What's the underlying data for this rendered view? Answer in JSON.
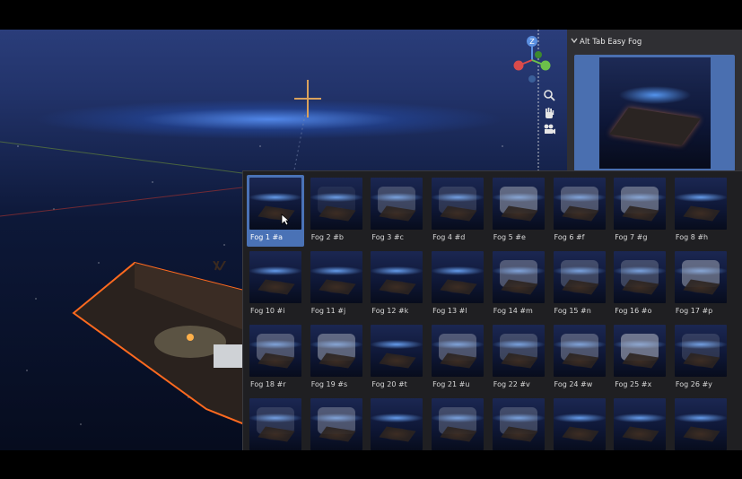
{
  "panel": {
    "title": "Alt Tab Easy Fog",
    "collapse_icon": "chevron-down-icon"
  },
  "viewport": {
    "gizmo_axes": [
      "Z",
      "Y",
      "X"
    ],
    "nav_icons": [
      "zoom-icon",
      "pan-hand-icon",
      "camera-icon"
    ]
  },
  "fog_presets": [
    {
      "label": "Fog 1 #a",
      "selected": true,
      "fog": 0.0
    },
    {
      "label": "Fog 2 #b",
      "selected": false,
      "fog": 0.1
    },
    {
      "label": "Fog 3 #c",
      "selected": false,
      "fog": 0.3
    },
    {
      "label": "Fog 4 #d",
      "selected": false,
      "fog": 0.2
    },
    {
      "label": "Fog 5 #e",
      "selected": false,
      "fog": 0.5
    },
    {
      "label": "Fog 6 #f",
      "selected": false,
      "fog": 0.4
    },
    {
      "label": "Fog 7 #g",
      "selected": false,
      "fog": 0.5
    },
    {
      "label": "Fog 8 #h",
      "selected": false,
      "fog": 0.0
    },
    {
      "label": "Fog 10 #i",
      "selected": false,
      "fog": 0.0
    },
    {
      "label": "Fog 11 #j",
      "selected": false,
      "fog": 0.0
    },
    {
      "label": "Fog 12 #k",
      "selected": false,
      "fog": 0.0
    },
    {
      "label": "Fog 13 #l",
      "selected": false,
      "fog": 0.0
    },
    {
      "label": "Fog 14 #m",
      "selected": false,
      "fog": 0.4
    },
    {
      "label": "Fog 15 #n",
      "selected": false,
      "fog": 0.3
    },
    {
      "label": "Fog 16 #o",
      "selected": false,
      "fog": 0.3
    },
    {
      "label": "Fog 17 #p",
      "selected": false,
      "fog": 0.5
    },
    {
      "label": "Fog 18 #r",
      "selected": false,
      "fog": 0.4
    },
    {
      "label": "Fog 19 #s",
      "selected": false,
      "fog": 0.5
    },
    {
      "label": "Fog 20 #t",
      "selected": false,
      "fog": 0.0
    },
    {
      "label": "Fog 21 #u",
      "selected": false,
      "fog": 0.4
    },
    {
      "label": "Fog 22 #v",
      "selected": false,
      "fog": 0.3
    },
    {
      "label": "Fog 24 #w",
      "selected": false,
      "fog": 0.4
    },
    {
      "label": "Fog 25 #x",
      "selected": false,
      "fog": 0.6
    },
    {
      "label": "Fog 26 #y",
      "selected": false,
      "fog": 0.2
    },
    {
      "label": "",
      "selected": false,
      "fog": 0.2
    },
    {
      "label": "",
      "selected": false,
      "fog": 0.4
    },
    {
      "label": "",
      "selected": false,
      "fog": 0.0
    },
    {
      "label": "",
      "selected": false,
      "fog": 0.3
    },
    {
      "label": "",
      "selected": false,
      "fog": 0.3
    },
    {
      "label": "",
      "selected": false,
      "fog": 0.0
    },
    {
      "label": "",
      "selected": false,
      "fog": 0.0
    },
    {
      "label": "",
      "selected": false,
      "fog": 0.0
    }
  ],
  "colors": {
    "selection": "#4a72b6",
    "crosshair": "#d9a15c",
    "panel_bg": "#2f2f33",
    "popup_bg": "#1f1f22"
  }
}
